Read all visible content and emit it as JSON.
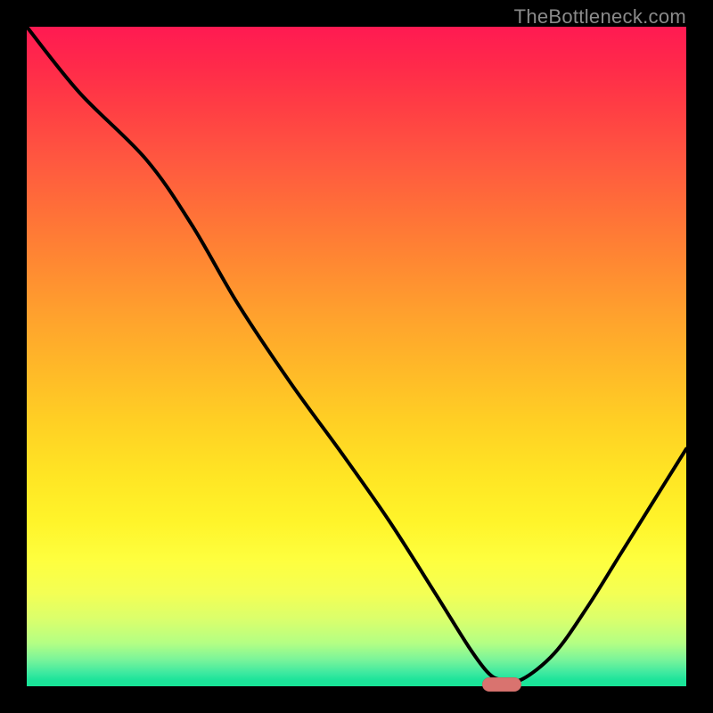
{
  "watermark": "TheBottleneck.com",
  "colors": {
    "background": "#000000",
    "marker": "#d9736f",
    "curve": "#000000"
  },
  "chart_data": {
    "type": "line",
    "title": "",
    "xlabel": "",
    "ylabel": "",
    "xlim": [
      0,
      100
    ],
    "ylim": [
      0,
      100
    ],
    "series": [
      {
        "name": "bottleneck-curve",
        "x": [
          0,
          8,
          18,
          25,
          32,
          40,
          48,
          55,
          62,
          67,
          70,
          72,
          75,
          80,
          85,
          90,
          95,
          100
        ],
        "values": [
          100,
          90,
          80,
          70,
          58,
          46,
          35,
          25,
          14,
          6,
          2,
          1,
          1,
          5,
          12,
          20,
          28,
          36
        ]
      }
    ],
    "marker": {
      "x_fraction": 0.72,
      "y_fraction": 0.0
    },
    "gradient_stops": [
      {
        "pos": 0,
        "color": "#ff1a52"
      },
      {
        "pos": 50,
        "color": "#ffb928"
      },
      {
        "pos": 80,
        "color": "#feff3f"
      },
      {
        "pos": 100,
        "color": "#18e497"
      }
    ]
  }
}
